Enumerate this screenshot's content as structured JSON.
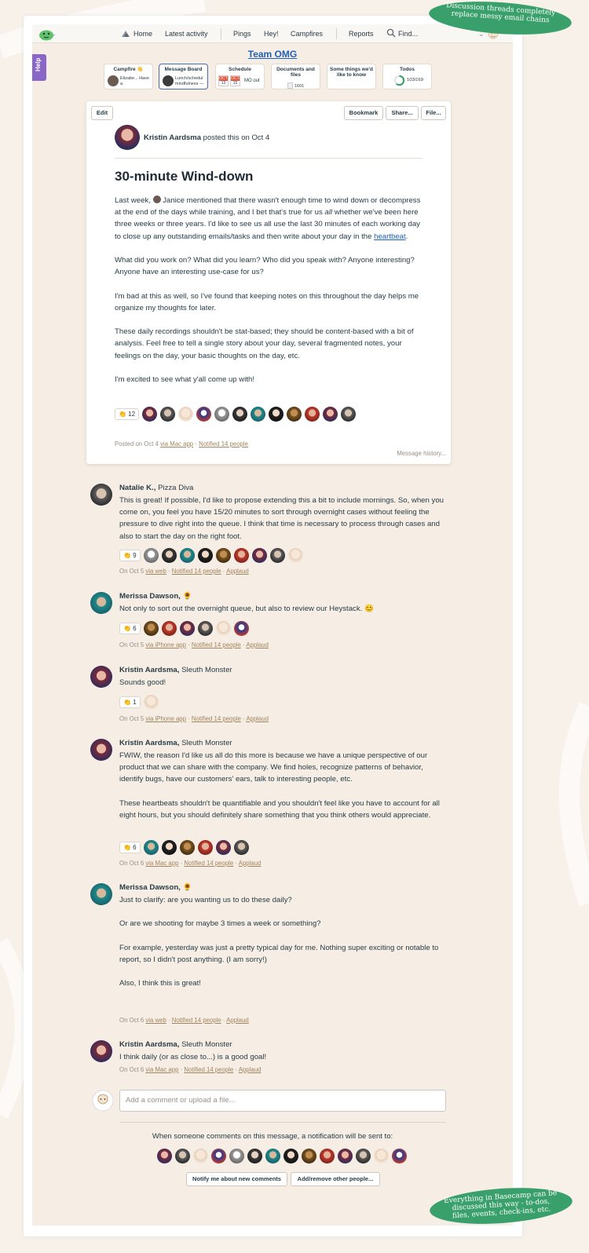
{
  "nav": {
    "home": "Home",
    "latest_activity": "Latest activity",
    "pings": "Pings",
    "hey": "Hey!",
    "campfires": "Campfires",
    "reports": "Reports",
    "find": "Find..."
  },
  "help_tab": "Help",
  "project": {
    "title": "Team OMG"
  },
  "tools": [
    {
      "title": "Campfire 👋",
      "detail": "Elizabe... Have a"
    },
    {
      "title": "Message Board",
      "detail": "Lunch/schedul mindfulness —"
    },
    {
      "title": "Schedule",
      "detail": "MO out",
      "day1_month": "OCT",
      "day1": "13",
      "day2_month": "OCT",
      "day2": "15"
    },
    {
      "title": "Documents and files",
      "detail": "1601"
    },
    {
      "title": "Some things we'd like to know",
      "detail": ""
    },
    {
      "title": "Todos",
      "detail": "103/169",
      "progress": 0.609
    }
  ],
  "message": {
    "edit": "Edit",
    "bookmark": "Bookmark",
    "share": "Share...",
    "file": "File...",
    "author": "Kristin Aardsma",
    "posted_suffix": "posted this on Oct 4",
    "title": "30-minute Wind-down",
    "p1_a": "Last week, ",
    "p1_b": " Janice mentioned that there wasn't enough time to wind down or decompress at the end of the days while training, and I bet that's true for us ",
    "p1_em": "all",
    "p1_c": " whether we've been here three weeks or three years. I'd like to see us all use the last 30 minutes of each working day to close up any outstanding emails/tasks and then write about your day in the ",
    "p1_link": "heartbeat",
    "p1_d": ".",
    "p2": "What did you work on? What did you learn? Who did you speak with? Anyone interesting? Anyone have an interesting use-case for us?",
    "p3": "I'm bad at this as well, so I've found that keeping notes on this throughout the day helps me organize my thoughts for later.",
    "p4": "These daily recordings shouldn't be stat-based; they should be content-based with a bit of analysis. Feel free to tell a single story about your day, several fragmented notes, your feelings on the day, your basic thoughts on the day, etc.",
    "p5": "I'm excited to see what y'all come up with!",
    "claps": "👏 12",
    "meta_a": "Posted on Oct 4",
    "meta_via": "via Mac app",
    "meta_dot": "·",
    "meta_notified": "Notified 14 people",
    "history": "Message history..."
  },
  "comments": [
    {
      "author": "Natalie K.,",
      "role": "Pizza Diva",
      "text": [
        "This is great! If possible, I'd like to propose extending this a bit to include mornings. So, when you come on, you feel you have 15/20 minutes to sort through overnight cases without feeling the pressure to dive right into the queue. I think that time is necessary to process through cases and also to start the day on the right foot."
      ],
      "claps": "👏 9",
      "date": "On Oct 5",
      "via": "via web",
      "notified": "Notified 14 people",
      "applaud": "Applaud"
    },
    {
      "author": "Merissa Dawson,",
      "role": "🌻",
      "text": [
        "Not only to sort out the overnight queue, but also to review our Heystack. 😊"
      ],
      "claps": "👏 6",
      "date": "On Oct 5",
      "via": "via iPhone app",
      "notified": "Notified 14 people",
      "applaud": "Applaud"
    },
    {
      "author": "Kristin Aardsma,",
      "role": "Sleuth Monster",
      "text": [
        "Sounds good!"
      ],
      "claps": "👏 1",
      "date": "On Oct 5",
      "via": "via iPhone app",
      "notified": "Notified 14 people",
      "applaud": "Applaud"
    },
    {
      "author": "Kristin Aardsma,",
      "role": "Sleuth Monster",
      "text": [
        "FWIW, the reason I'd like us all do this more is because we have a unique perspective of our product that we can share with the company. We find holes, recognize patterns of behavior, identify bugs, have our customers' ears, talk to interesting people, etc.",
        "These heartbeats shouldn't be quantifiable and you shouldn't feel like you have to account for all eight hours, but you should definitely share something that you think others would appreciate."
      ],
      "claps": "👏 6",
      "date": "On Oct 6",
      "via": "via Mac app",
      "notified": "Notified 14 people",
      "applaud": "Applaud"
    },
    {
      "author": "Merissa Dawson,",
      "role": "🌻",
      "text": [
        "Just to clarify: are you wanting us to do these daily?",
        "Or are we shooting for maybe 3 times a week or something?",
        "For example, yesterday was just a pretty typical day for me. Nothing super exciting or notable to report, so I didn't post anything. (I am sorry!)",
        "Also, I think this is great!"
      ],
      "claps": "",
      "date": "On Oct 6",
      "via": "via web",
      "notified": "Notified 14 people",
      "applaud": "Applaud"
    },
    {
      "author": "Kristin Aardsma,",
      "role": "Sleuth Monster",
      "text": [
        "I think daily (or as close to...) is a good goal!"
      ],
      "claps": "",
      "date": "On Oct 6",
      "via": "via Mac app",
      "notified": "Notified 14 people",
      "applaud": "Applaud"
    }
  ],
  "composer": {
    "placeholder": "Add a comment or upload a file..."
  },
  "notification": {
    "text": "When someone comments on this message, a notification will be sent to:",
    "notify_button": "Notify me about new comments",
    "addremove_button": "Add/remove other people..."
  },
  "callouts": {
    "top": "Discussion threads completely replace messy email chains",
    "bottom": "Everything in Basecamp can be discussed this way - to-dos, files, events, check-ins, etc."
  },
  "colors": {
    "accent": "#1f61b6",
    "callout": "#3aa06b",
    "help": "#8a67c6",
    "background": "#f6ede4"
  }
}
